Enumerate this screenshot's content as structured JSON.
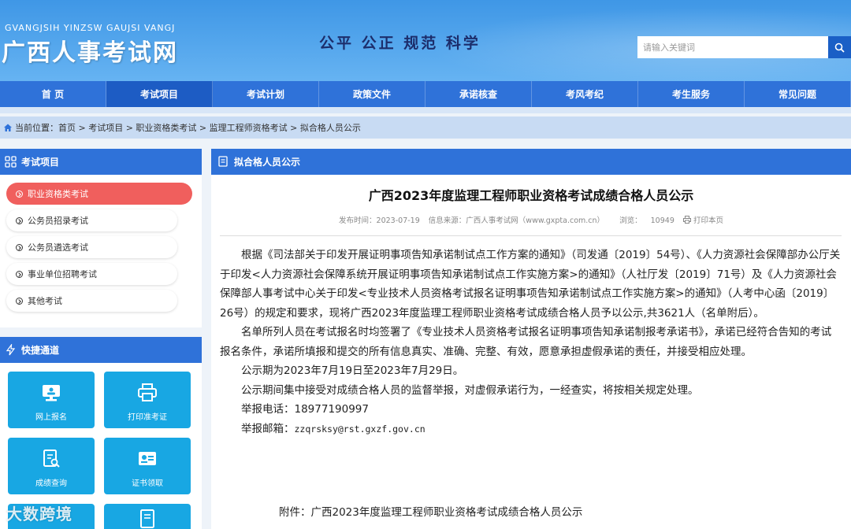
{
  "header": {
    "logo_pinyin": "GVANGJSIH YINZSW GAUJSI VANGJ",
    "logo_title": "广西人事考试网",
    "slogan": "公平 公正 规范 科学",
    "search_placeholder": "请输入关键词"
  },
  "nav": {
    "items": [
      {
        "label": "首 页"
      },
      {
        "label": "考试项目"
      },
      {
        "label": "考试计划"
      },
      {
        "label": "政策文件"
      },
      {
        "label": "承诺核查"
      },
      {
        "label": "考风考纪"
      },
      {
        "label": "考生服务"
      },
      {
        "label": "常见问题"
      }
    ]
  },
  "breadcrumb": {
    "prefix": "当前位置：",
    "path": "首页 > 考试项目 > 职业资格类考试 > 监理工程师资格考试 > 拟合格人员公示"
  },
  "sidebar": {
    "title": "考试项目",
    "items": [
      {
        "label": "职业资格类考试"
      },
      {
        "label": "公务员招录考试"
      },
      {
        "label": "公务员遴选考试"
      },
      {
        "label": "事业单位招聘考试"
      },
      {
        "label": "其他考试"
      }
    ]
  },
  "quick": {
    "title": "快捷通道",
    "tiles": [
      {
        "label": "网上报名",
        "icon": "monitor-icon"
      },
      {
        "label": "打印准考证",
        "icon": "printer-icon"
      },
      {
        "label": "成绩查询",
        "icon": "search-doc-icon"
      },
      {
        "label": "证书领取",
        "icon": "id-card-icon"
      }
    ]
  },
  "main": {
    "panel_title": "拟合格人员公示",
    "title": "广西2023年度监理工程师职业资格考试成绩合格人员公示",
    "meta": {
      "date": "发布时间：2023-07-19",
      "source": "信息来源：广西人事考试网（www.gxpta.com.cn）",
      "views_label": "浏览：",
      "views": "10949",
      "print": "打印本页"
    },
    "paragraphs": [
      "根据《司法部关于印发开展证明事项告知承诺制试点工作方案的通知》（司发通〔2019〕54号）、《人力资源社会保障部办公厅关于印发<人力资源社会保障系统开展证明事项告知承诺制试点工作实施方案>的通知》（人社厅发〔2019〕71号）及《人力资源社会保障部人事考试中心关于印发<专业技术人员资格考试报名证明事项告知承诺制试点工作实施方案>的通知》（人考中心函〔2019〕26号）的规定和要求，现将广西2023年度监理工程师职业资格考试成绩合格人员予以公示,共3621人（名单附后）。",
      "名单所列人员在考试报名时均签署了《专业技术人员资格考试报名证明事项告知承诺制报考承诺书》，承诺已经符合告知的考试报名条件，承诺所填报和提交的所有信息真实、准确、完整、有效，愿意承担虚假承诺的责任，并接受相应处理。",
      "公示期为2023年7月19日至2023年7月29日。",
      "公示期间集中接受对成绩合格人员的监督举报，对虚假承诺行为，一经查实，将按相关规定处理。"
    ],
    "phone_label": "举报电话：",
    "phone": "18977190997",
    "email_label": "举报邮箱：",
    "email": "zzqrsksy@rst.gxzf.gov.cn",
    "attachment": "附件：广西2023年度监理工程师职业资格考试成绩合格人员公示"
  },
  "watermark": "大数跨境",
  "colors": {
    "nav": "#2f72d9",
    "active_nav": "#1d5cc4",
    "sidebar_active": "#f05f5d",
    "tile": "#18a7e3"
  }
}
